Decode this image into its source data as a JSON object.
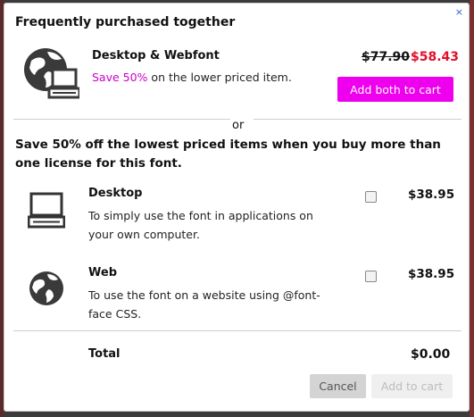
{
  "dialog": {
    "title": "Frequently purchased together",
    "close_glyph": "×"
  },
  "bundle": {
    "icon": "globe-and-desktop-icon",
    "name": "Desktop & Webfont",
    "promo": "Save 50%",
    "promo_rest": " on the lower priced item.",
    "old_price": "$77.90",
    "new_price": "$58.43",
    "button_label": "Add both to cart"
  },
  "divider": {
    "label": "or"
  },
  "info_text": "Save 50% off the lowest priced items when you buy more than one license for this font.",
  "options": [
    {
      "icon": "desktop-computer-icon",
      "name": "Desktop",
      "description": "To simply use the font in applications on your own computer.",
      "price": "$38.95",
      "checked": false
    },
    {
      "icon": "globe-icon",
      "name": "Web",
      "description": "To use the font on a website using @font-face CSS.",
      "price": "$38.95",
      "checked": false
    }
  ],
  "total": {
    "label": "Total",
    "value": "$0.00"
  },
  "actions": {
    "cancel_label": "Cancel",
    "add_to_cart_label": "Add to cart"
  },
  "colors": {
    "accent": "#ee00ee",
    "promo_text": "#cc00cc",
    "sale_price": "#e0102a",
    "close_link": "#2a62c9"
  }
}
